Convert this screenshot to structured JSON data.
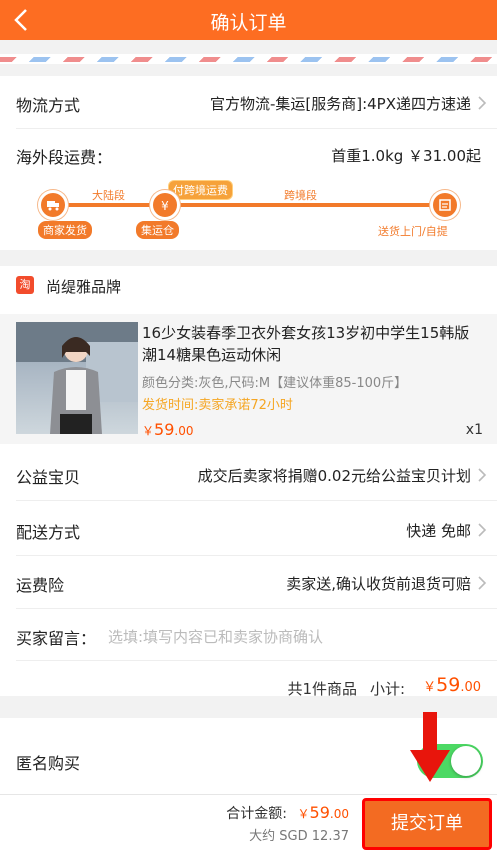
{
  "header": {
    "title": "确认订单",
    "back_icon": "chevron-left-icon"
  },
  "logistics": {
    "label": "物流方式",
    "value": "官方物流-集运[服务商]:4PX递四方速递"
  },
  "overseas_fee": {
    "label": "海外段运费：",
    "value": "首重1.0kg ￥31.00起"
  },
  "route": {
    "segments": [
      "大陆段",
      "跨境段"
    ],
    "callout": "付跨境运费",
    "stops": [
      "商家发货",
      "集运仓",
      "送货上门/自提"
    ]
  },
  "shop": {
    "icon_text": "淘",
    "name": "尚缇雅品牌"
  },
  "product": {
    "title": "16少女装春季卫衣外套女孩13岁初中学生15韩版潮14糖果色运动休闲",
    "spec": "颜色分类:灰色,尺码:M【建议体重85-100斤】",
    "ship_time": "发货时间:卖家承诺72小时",
    "price_symbol": "￥",
    "price_int": "59",
    "price_dec": ".00",
    "qty": "x1"
  },
  "charity": {
    "label": "公益宝贝",
    "value": "成交后卖家将捐赠0.02元给公益宝贝计划"
  },
  "delivery": {
    "label": "配送方式",
    "value": "快递 免邮"
  },
  "insurance": {
    "label": "运费险",
    "value": "卖家送,确认收货前退货可赔"
  },
  "message": {
    "label": "买家留言：",
    "placeholder": "选填:填写内容已和卖家协商确认"
  },
  "subtotal": {
    "count": "共1件商品",
    "label": "小计:",
    "symbol": "￥",
    "int": "59",
    "dec": ".00"
  },
  "anonymous": {
    "label": "匿名购买",
    "enabled": true
  },
  "footer": {
    "total_label": "合计金额:",
    "total_symbol": "￥",
    "total_int": "59",
    "total_dec": ".00",
    "approx": "大约 SGD 12.37",
    "submit": "提交订单"
  },
  "colors": {
    "brand": "#fd6d22",
    "price": "#ff5000",
    "toggle_on": "#4cd964",
    "highlight": "#ff0000"
  }
}
